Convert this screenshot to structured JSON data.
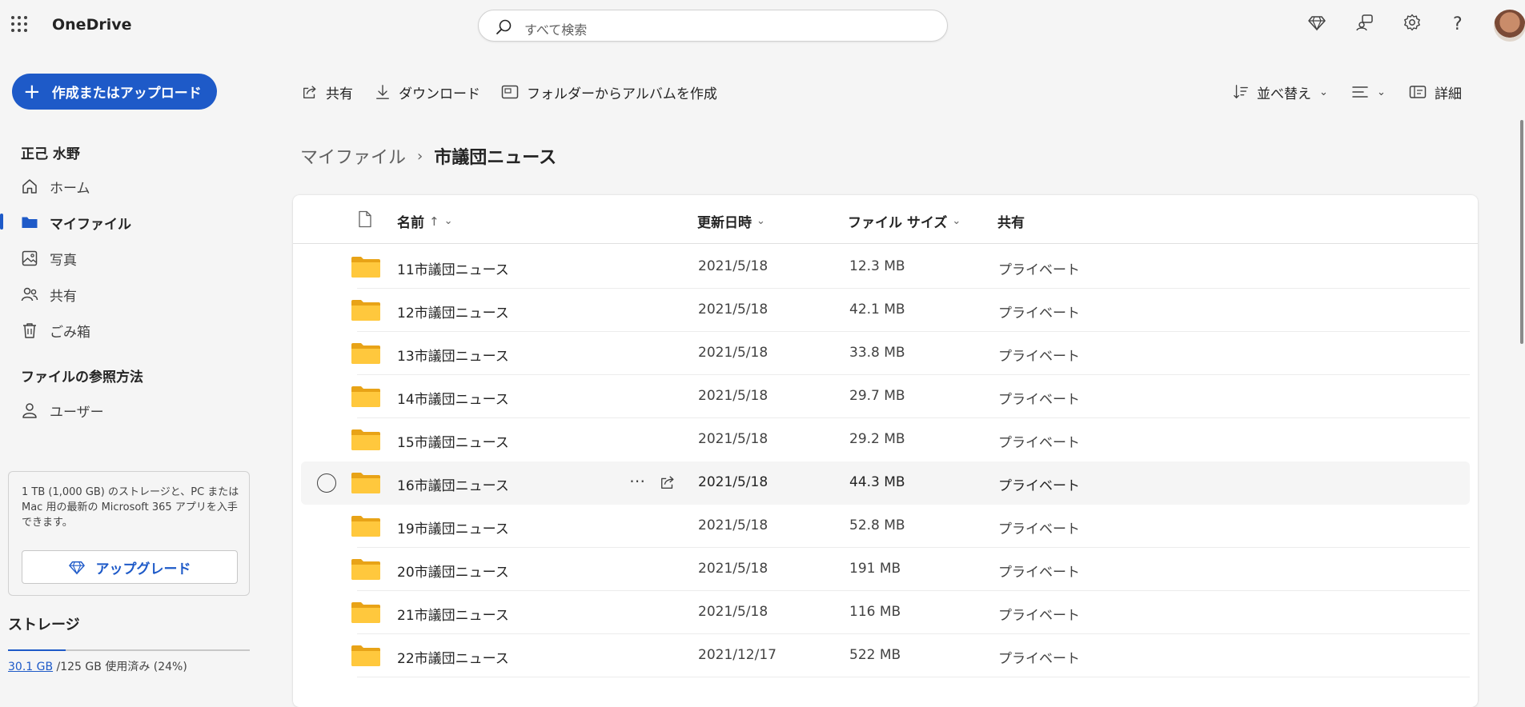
{
  "app": {
    "title": "OneDrive"
  },
  "search": {
    "placeholder": "すべて検索"
  },
  "nav": {
    "create_label": "作成またはアップロード",
    "user_name": "正己 水野",
    "items": [
      {
        "label": "ホーム",
        "icon": "home-icon"
      },
      {
        "label": "マイファイル",
        "icon": "folder-icon"
      },
      {
        "label": "写真",
        "icon": "photo-icon"
      },
      {
        "label": "共有",
        "icon": "people-icon"
      },
      {
        "label": "ごみ箱",
        "icon": "trash-icon"
      }
    ],
    "browse_section": "ファイルの参照方法",
    "browse_items": [
      {
        "label": "ユーザー",
        "icon": "person-icon"
      }
    ],
    "promo_text": "1 TB (1,000 GB) のストレージと、PC または Mac 用の最新の Microsoft 365 アプリを入手できます。",
    "upgrade_label": "アップグレード",
    "storage_title": "ストレージ",
    "storage_used": "30.1 GB",
    "storage_rest": " /125 GB 使用済み (24%)",
    "storage_fraction": 0.24
  },
  "commands": {
    "share": "共有",
    "download": "ダウンロード",
    "album": "フォルダーからアルバムを作成",
    "sort": "並べ替え",
    "details": "詳細"
  },
  "breadcrumb": {
    "root": "マイファイル",
    "current": "市議団ニュース"
  },
  "table": {
    "headers": {
      "name": "名前",
      "modified": "更新日時",
      "size": "ファイル サイズ",
      "sharing": "共有"
    },
    "rows": [
      {
        "name": "11市議団ニュース",
        "modified": "2021/5/18",
        "size": "12.3 MB",
        "sharing": "プライベート"
      },
      {
        "name": "12市議団ニュース",
        "modified": "2021/5/18",
        "size": "42.1 MB",
        "sharing": "プライベート"
      },
      {
        "name": "13市議団ニュース",
        "modified": "2021/5/18",
        "size": "33.8 MB",
        "sharing": "プライベート"
      },
      {
        "name": "14市議団ニュース",
        "modified": "2021/5/18",
        "size": "29.7 MB",
        "sharing": "プライベート"
      },
      {
        "name": "15市議団ニュース",
        "modified": "2021/5/18",
        "size": "29.2 MB",
        "sharing": "プライベート"
      },
      {
        "name": "16市議団ニュース",
        "modified": "2021/5/18",
        "size": "44.3 MB",
        "sharing": "プライベート"
      },
      {
        "name": "19市議団ニュース",
        "modified": "2021/5/18",
        "size": "52.8 MB",
        "sharing": "プライベート"
      },
      {
        "name": "20市議団ニュース",
        "modified": "2021/5/18",
        "size": "191 MB",
        "sharing": "プライベート"
      },
      {
        "name": "21市議団ニュース",
        "modified": "2021/5/18",
        "size": "116 MB",
        "sharing": "プライベート"
      },
      {
        "name": "22市議団ニュース",
        "modified": "2021/12/17",
        "size": "522 MB",
        "sharing": "プライベート"
      }
    ],
    "hover_row_index": 5
  },
  "colors": {
    "accent": "#1e5ac8",
    "folder": "#ffc83d",
    "background": "#f5f5f5"
  }
}
